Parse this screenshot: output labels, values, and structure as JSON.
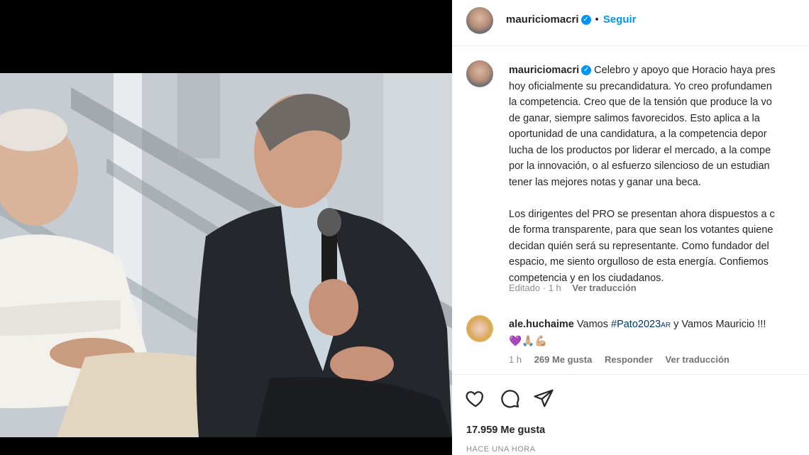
{
  "post": {
    "username": "mauriciomacri",
    "verified_mark": "✓",
    "separator": "•",
    "follow_label": "Seguir"
  },
  "caption": {
    "username": "mauriciomacri",
    "text": "Celebro y apoyo que Horacio haya pres\nhoy oficialmente su precandidatura. Yo creo profundamen\nla competencia. Creo que de la tensión que produce la vo\nde ganar, siempre salimos favorecidos. Esto aplica a la\noportunidad de una candidatura, a la competencia depor\nlucha de los productos por liderar el mercado, a la compe\npor la innovación, o al esfuerzo silencioso de un estudian\ntener las mejores notas y ganar una beca.\n\nLos dirigentes del PRO se presentan ahora dispuestos a c\nde forma transparente, para que sean los votantes quiene\ndecidan quién será su representante. Como fundador del\nespacio, me siento orgulloso de esta energía. Confiemos\ncompetencia y en los ciudadanos.",
    "edited": "Editado",
    "meta_dot": "·",
    "time": "1 h",
    "translate_label": "Ver traducción"
  },
  "comment": {
    "username": "ale.huchaime",
    "text_before": "Vamos ",
    "hashtag": "#Pato2023",
    "flag": "AR",
    "text_after": " y Vamos Mauricio !!!",
    "emojis": "💜🙏🏼💪🏼",
    "time": "1 h",
    "likes": "269 Me gusta",
    "reply_label": "Responder",
    "translate_label": "Ver traducción"
  },
  "actions": {
    "like_icon": "heart-icon",
    "comment_icon": "comment-icon",
    "share_icon": "share-icon"
  },
  "likes_count": "17.959 Me gusta",
  "time_ago": "HACE UNA HORA",
  "colors": {
    "accent": "#0095f6",
    "text": "#262626",
    "muted": "#8e8e8e",
    "hashtag": "#00376b"
  }
}
